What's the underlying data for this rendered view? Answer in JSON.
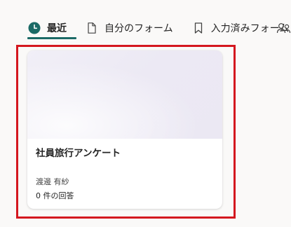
{
  "tabs": [
    {
      "label": "最近",
      "icon": "clock-icon",
      "active": true
    },
    {
      "label": "自分のフォーム",
      "icon": "document-icon",
      "active": false
    },
    {
      "label": "入力済みフォーム",
      "icon": "bookmark-icon",
      "active": false
    }
  ],
  "tab_more_icon": "people-icon",
  "colors": {
    "accent": "#1b6a66",
    "highlight_border": "#d4171f",
    "card_thumbnail": "#ece9f4",
    "background": "#faf9f8"
  },
  "form_card": {
    "title": "社員旅行アンケート",
    "owner": "渡邊 有紗",
    "responses": "0 件の回答"
  }
}
